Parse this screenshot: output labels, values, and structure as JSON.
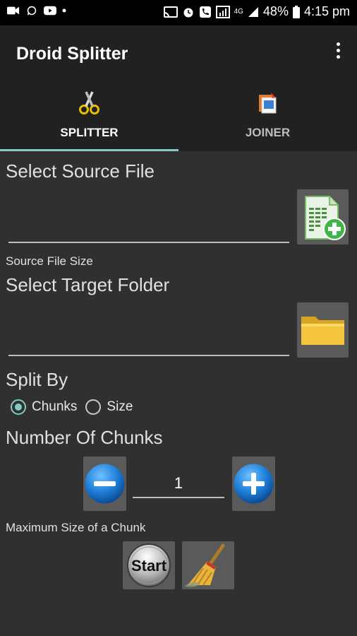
{
  "status_bar": {
    "battery": "48%",
    "time": "4:15 pm",
    "network": "4G",
    "left_icons": [
      "video-call-icon",
      "whatsapp-icon",
      "youtube-icon",
      "dot-icon"
    ],
    "right_icons": [
      "cast-icon",
      "alarm-icon",
      "phone-icon",
      "data-icon",
      "signal-icon",
      "battery-icon"
    ]
  },
  "app_bar": {
    "title": "Droid Splitter",
    "menu_icon": "more-vert-icon"
  },
  "tabs": [
    {
      "label": "SPLITTER",
      "icon": "scissors-icon",
      "selected": true
    },
    {
      "label": "JOINER",
      "icon": "joiner-icon",
      "selected": false
    }
  ],
  "source": {
    "heading": "Select Source File",
    "value": "",
    "size_label": "Source File Size",
    "button_icon": "add-file-icon"
  },
  "target": {
    "heading": "Select Target Folder",
    "value": "",
    "button_icon": "folder-icon"
  },
  "split_by": {
    "heading": "Split By",
    "options": [
      {
        "label": "Chunks",
        "selected": true
      },
      {
        "label": "Size",
        "selected": false
      }
    ]
  },
  "chunks": {
    "heading": "Number Of Chunks",
    "value": "1",
    "minus_icon": "minus-circle-icon",
    "plus_icon": "plus-circle-icon",
    "max_size_label": "Maximum Size of a Chunk"
  },
  "actions": {
    "start_label": "Start",
    "clear_icon": "broom-icon"
  },
  "colors": {
    "accent": "#80cbc4",
    "background": "#303030",
    "app_bar": "#212121",
    "status_bar": "#000000"
  }
}
